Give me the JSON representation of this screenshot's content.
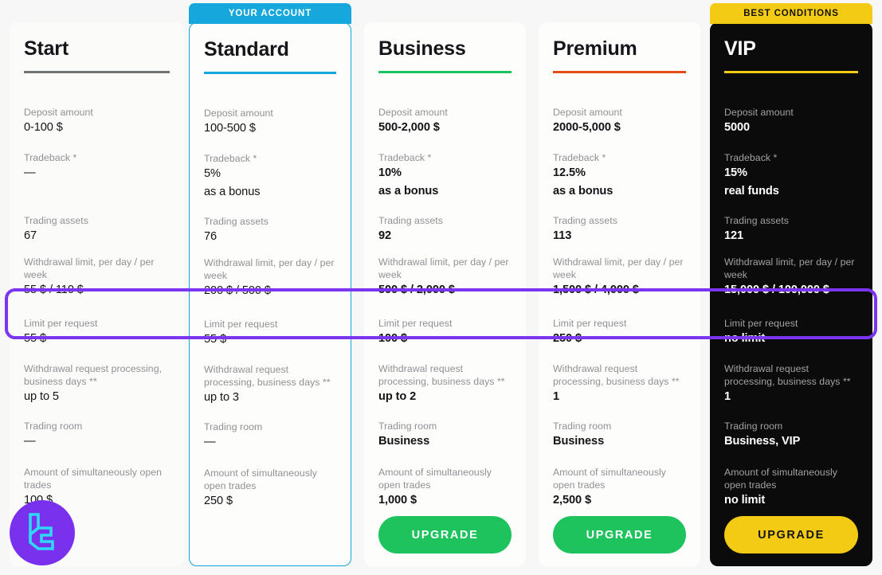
{
  "page": {
    "background": "#f7f7f7",
    "highlighted_row": "Limit per request",
    "highlight_color": "#7b35f0"
  },
  "logo": {
    "name": "brand-logo",
    "circle_color": "#7a31ee",
    "mark_color": "#2fd8f5"
  },
  "ribbons": {
    "standard": {
      "label": "YOUR ACCOUNT",
      "bg": "#16a8dd",
      "fg": "#ffffff"
    },
    "vip": {
      "label": "BEST CONDITIONS",
      "bg": "#f3cb14",
      "fg": "#111111"
    }
  },
  "row_labels": {
    "deposit": "Deposit amount",
    "tradeback": "Tradeback *",
    "assets": "Trading assets",
    "withdraw": "Withdrawal limit, per day / per week",
    "limit": "Limit per request",
    "process": "Withdrawal request processing, business days **",
    "room": "Trading room",
    "trades": "Amount of simultaneously open trades"
  },
  "plans": [
    {
      "id": "start",
      "title": "Start",
      "accent": "#6f7376",
      "bold": false,
      "deposit": "0-100 $",
      "tradeback": "—",
      "tradeback_extra": "",
      "assets": "67",
      "withdraw": "55 $ / 110 $",
      "limit": "55 $",
      "process": "up to 5",
      "room": "—",
      "trades": "100 $",
      "button": null
    },
    {
      "id": "standard",
      "title": "Standard",
      "accent": "#16a8dd",
      "bold": false,
      "deposit": "100-500 $",
      "tradeback": "5%",
      "tradeback_extra": "as a bonus",
      "assets": "76",
      "withdraw": "200 $ / 500 $",
      "limit": "55 $",
      "process": "up to 3",
      "room": "—",
      "trades": "250 $",
      "button": null
    },
    {
      "id": "business",
      "title": "Business",
      "accent": "#17c45f",
      "bold": true,
      "deposit": "500-2,000 $",
      "tradeback": "10%",
      "tradeback_extra": "as a bonus",
      "assets": "92",
      "withdraw": "500 $ / 2,000 $",
      "limit": "100 $",
      "process": "up to 2",
      "room": "Business",
      "trades": "1,000 $",
      "button": {
        "label": "UPGRADE",
        "style": "green"
      }
    },
    {
      "id": "premium",
      "title": "Premium",
      "accent": "#e44b16",
      "bold": true,
      "deposit": "2000-5,000 $",
      "tradeback": "12.5%",
      "tradeback_extra": "as a bonus",
      "assets": "113",
      "withdraw": "1,500 $ / 4,000 $",
      "limit": "250 $",
      "process": "1",
      "room": "Business",
      "trades": "2,500 $",
      "button": {
        "label": "UPGRADE",
        "style": "green"
      }
    },
    {
      "id": "vip",
      "title": "VIP",
      "accent": "#f3cb14",
      "bold": true,
      "deposit": "5000",
      "tradeback": "15%",
      "tradeback_extra": "real funds",
      "assets": "121",
      "withdraw": "15,000 $ / 100,000 $",
      "limit": "no limit",
      "process": "1",
      "room": "Business, VIP",
      "trades": "no limit",
      "button": {
        "label": "UPGRADE",
        "style": "yellow"
      }
    }
  ]
}
